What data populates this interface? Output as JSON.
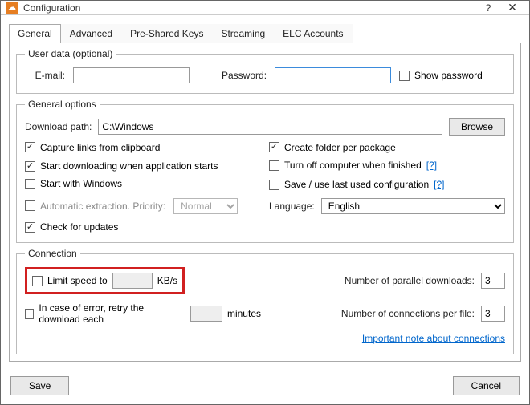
{
  "titlebar": {
    "title": "Configuration",
    "help": "?",
    "close": "✕"
  },
  "tabs": [
    "General",
    "Advanced",
    "Pre-Shared Keys",
    "Streaming",
    "ELC Accounts"
  ],
  "userdata": {
    "legend": "User data (optional)",
    "email_label": "E-mail:",
    "email_value": "",
    "password_label": "Password:",
    "password_value": "",
    "show_password_label": "Show password"
  },
  "general": {
    "legend": "General options",
    "download_path_label": "Download path:",
    "download_path_value": "C:\\Windows",
    "browse_label": "Browse",
    "capture_links_label": "Capture links from clipboard",
    "start_download_label": "Start downloading when application starts",
    "start_windows_label": "Start with Windows",
    "auto_extract_label": "Automatic extraction. Priority:",
    "priority_value": "Normal",
    "check_updates_label": "Check for updates",
    "create_folder_label": "Create folder per package",
    "turnoff_label": "Turn off computer when finished",
    "save_last_label": "Save / use last used configuration",
    "language_label": "Language:",
    "language_value": "English",
    "help_link": "[?]"
  },
  "connection": {
    "legend": "Connection",
    "limit_speed_label": "Limit speed to",
    "limit_speed_unit": "KB/s",
    "retry_label": "In case of error, retry the download each",
    "retry_unit": "minutes",
    "parallel_label": "Number of parallel downloads:",
    "parallel_value": "3",
    "perfile_label": "Number of connections per file:",
    "perfile_value": "3",
    "note_link": "Important note about connections"
  },
  "footer": {
    "save": "Save",
    "cancel": "Cancel"
  }
}
